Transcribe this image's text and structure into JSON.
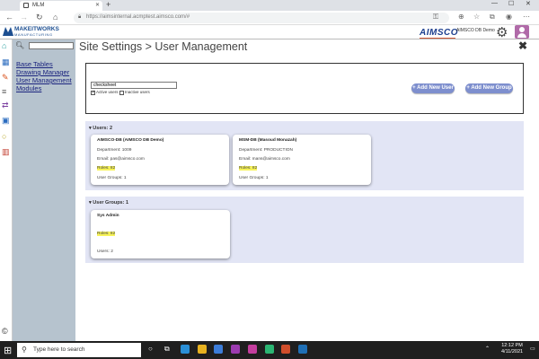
{
  "browser": {
    "tab_title": "MLM",
    "url": "https://aimsinternal.acmptest.aimsco.com/#"
  },
  "header": {
    "logo_name": "MAKEITWORKS",
    "logo_sub": "MANUFACTURING",
    "brand": "AIMSCO",
    "company": "AIMSCO DB Demo"
  },
  "sidebar": {
    "links": [
      "Base Tables",
      "Drawing Manager",
      "User Management",
      "Modules"
    ]
  },
  "page": {
    "title": "Site Settings > User Management",
    "search_value": "checksheet",
    "active_label": "Active users",
    "inactive_label": "Inactive users",
    "add_user_label": "Add New User",
    "add_group_label": "Add New Group"
  },
  "users_section": {
    "header": "Users: 2",
    "cards": [
      {
        "name": "AIMSCO-DB (AIMSCO DB Demo)",
        "department": "Department: 1009",
        "email": "Email: pas@aimsco.com",
        "roles": "Roles: 82",
        "groups": "User Groups: 1"
      },
      {
        "name": "MSM-DB (Masoud Monazah)",
        "department": "Department: PRODUCTION",
        "email": "Email: mans@aimsco.com",
        "roles": "Roles: 82",
        "groups": "User Groups: 1"
      }
    ]
  },
  "groups_section": {
    "header": "User Groups: 1",
    "cards": [
      {
        "name": "Sys Admin",
        "roles": "Roles: 82",
        "users": "Users: 2"
      }
    ]
  },
  "taskbar": {
    "search_placeholder": "Type here to search",
    "time": "12:12 PM",
    "date": "4/11/2021"
  },
  "colors": {
    "button": "#7e8fce",
    "section_bg": "#e2e5f5",
    "sidebar_bg": "#b6c3ce",
    "highlight": "#f7f35a"
  }
}
